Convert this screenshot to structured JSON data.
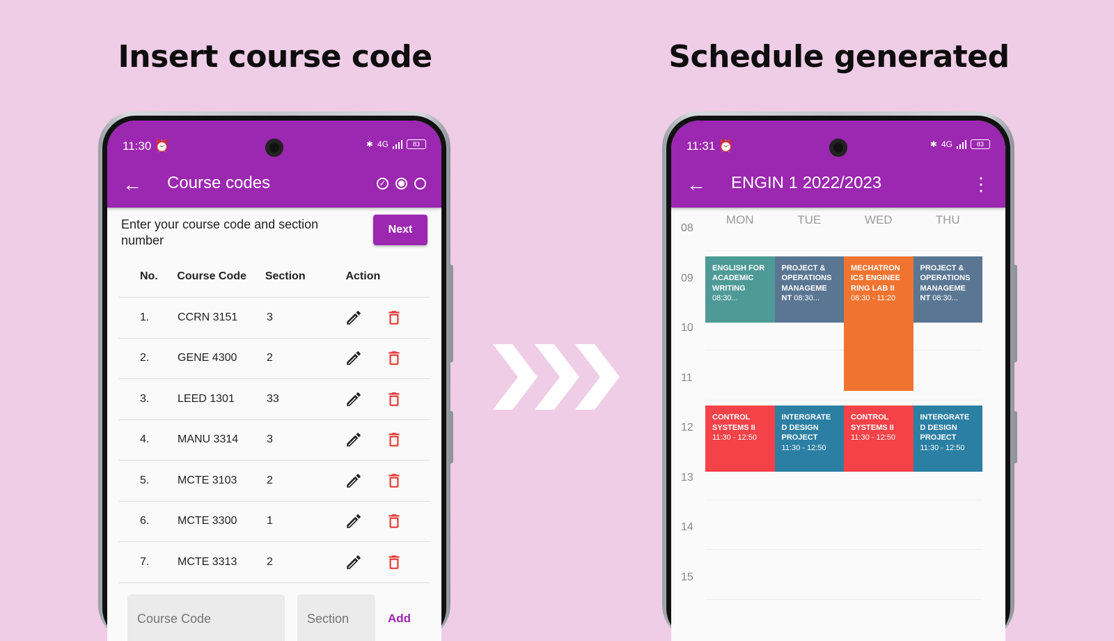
{
  "headings": {
    "left": "Insert course code",
    "right": "Schedule generated"
  },
  "left_phone": {
    "status": {
      "time": "11:30",
      "battery": "83",
      "network": "4G"
    },
    "appbar": {
      "title": "Course codes"
    },
    "instruction": "Enter your course code and section number",
    "next_label": "Next",
    "table": {
      "headers": {
        "no": "No.",
        "code": "Course Code",
        "section": "Section",
        "action": "Action"
      },
      "rows": [
        {
          "no": "1.",
          "code": "CCRN 3151",
          "section": "3"
        },
        {
          "no": "2.",
          "code": "GENE 4300",
          "section": "2"
        },
        {
          "no": "3.",
          "code": "LEED 1301",
          "section": "33"
        },
        {
          "no": "4.",
          "code": "MANU 3314",
          "section": "3"
        },
        {
          "no": "5.",
          "code": "MCTE 3103",
          "section": "2"
        },
        {
          "no": "6.",
          "code": "MCTE 3300",
          "section": "1"
        },
        {
          "no": "7.",
          "code": "MCTE 3313",
          "section": "2"
        }
      ]
    },
    "course_placeholder": "Course Code",
    "section_placeholder": "Section",
    "add_label": "Add"
  },
  "right_phone": {
    "status": {
      "time": "11:31",
      "battery": "83",
      "network": "4G"
    },
    "appbar": {
      "title": "ENGIN 1 2022/2023"
    },
    "days": [
      "MON",
      "TUE",
      "WED",
      "THU"
    ],
    "hours": [
      "08",
      "09",
      "10",
      "11",
      "12",
      "13",
      "14",
      "15"
    ],
    "events": [
      {
        "day": 0,
        "start": 8.5,
        "end": 9.83,
        "title": "ENGLISH FOR ACADEMIC WRITING",
        "time": "08:30...",
        "color": "#4e9a96"
      },
      {
        "day": 1,
        "start": 8.5,
        "end": 9.83,
        "title": "PROJECT & OPERATIONS MANAGEME NT",
        "time": "08:30...",
        "color": "#5a7693"
      },
      {
        "day": 2,
        "start": 8.5,
        "end": 11.2,
        "title": "MECHATRON ICS ENGINEE RING LAB II",
        "time": "08:30 - 11:20",
        "color": "#f07430"
      },
      {
        "day": 3,
        "start": 8.5,
        "end": 9.83,
        "title": "PROJECT & OPERATIONS MANAGEME NT",
        "time": "08:30...",
        "color": "#5a7693"
      },
      {
        "day": 0,
        "start": 11.5,
        "end": 12.83,
        "title": "CONTROL SYSTEMS II",
        "time": "11:30 - 12:50",
        "color": "#f44248"
      },
      {
        "day": 1,
        "start": 11.5,
        "end": 12.83,
        "title": "INTERGRATE D DESIGN PROJECT",
        "time": "11:30 - 12:50",
        "color": "#2b7fa3"
      },
      {
        "day": 2,
        "start": 11.5,
        "end": 12.83,
        "title": "CONTROL SYSTEMS II",
        "time": "11:30 - 12:50",
        "color": "#f44248"
      },
      {
        "day": 3,
        "start": 11.5,
        "end": 12.83,
        "title": "INTERGRATE D DESIGN PROJECT",
        "time": "11:30 - 12:50",
        "color": "#2b7fa3"
      }
    ]
  },
  "colors": {
    "background": "#efcde6",
    "primary": "#9c27b0",
    "delete": "#e53935"
  }
}
